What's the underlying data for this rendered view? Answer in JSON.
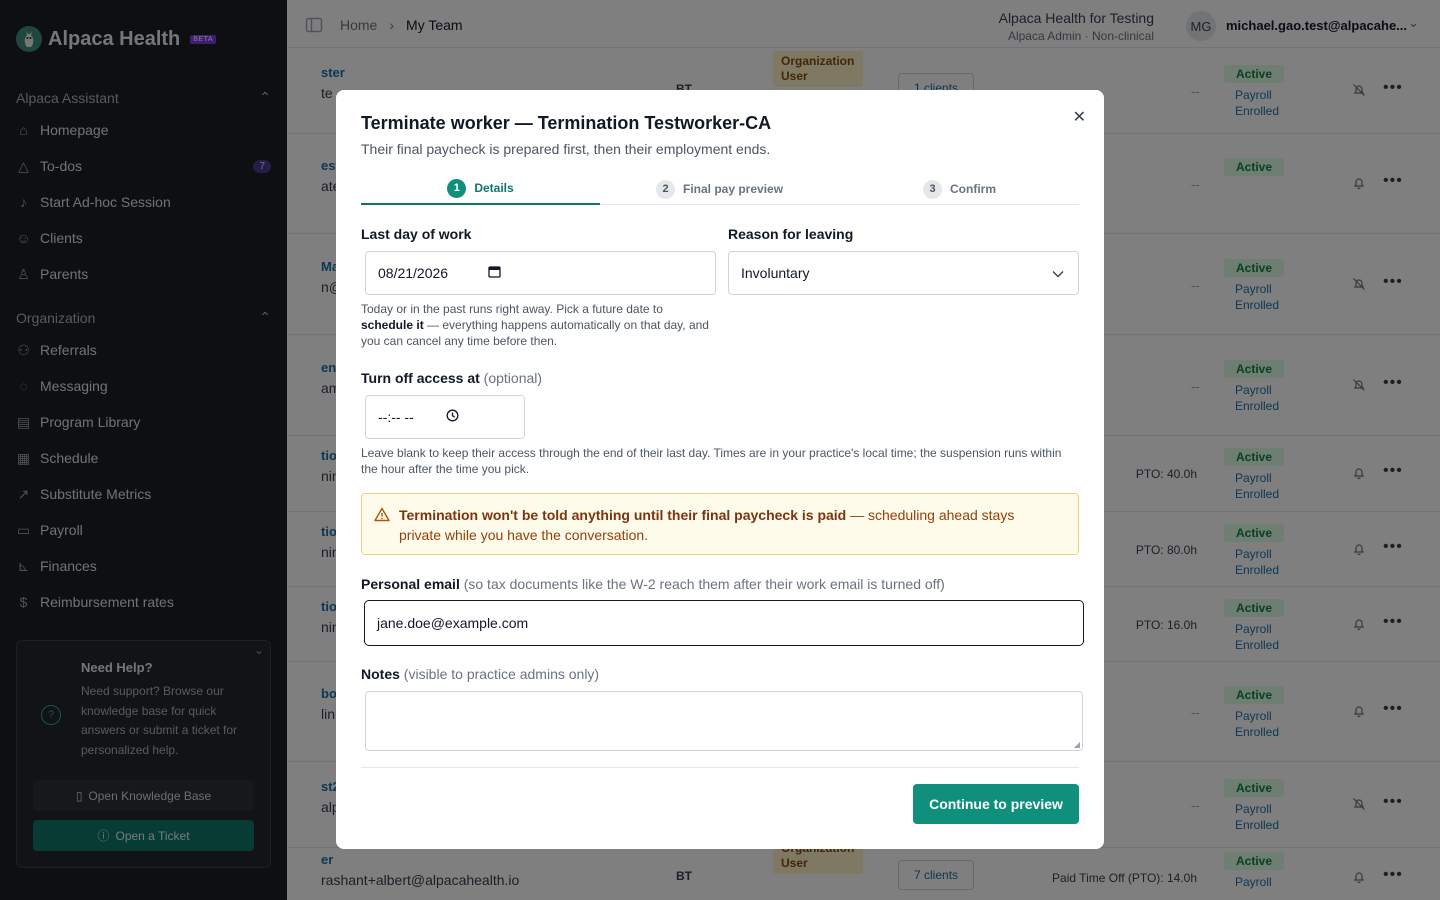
{
  "app": {
    "brand": "Alpaca Health",
    "beta": "BETA"
  },
  "sidebar": {
    "section_assistant": "Alpaca Assistant",
    "assistant_items": [
      {
        "label": "Homepage",
        "icon": "home-icon"
      },
      {
        "label": "To-dos",
        "icon": "warning-icon",
        "badge": "7"
      },
      {
        "label": "Start Ad-hoc Session",
        "icon": "mic-icon"
      },
      {
        "label": "Clients",
        "icon": "users-icon"
      },
      {
        "label": "Parents",
        "icon": "person-icon"
      }
    ],
    "section_org": "Organization",
    "org_items": [
      {
        "label": "Referrals",
        "icon": "referral-icon"
      },
      {
        "label": "Messaging",
        "icon": "chat-icon"
      },
      {
        "label": "Program Library",
        "icon": "library-icon"
      },
      {
        "label": "Schedule",
        "icon": "calendar-icon"
      },
      {
        "label": "Substitute Metrics",
        "icon": "trend-icon"
      },
      {
        "label": "Payroll",
        "icon": "wallet-icon"
      },
      {
        "label": "Finances",
        "icon": "chart-icon"
      },
      {
        "label": "Reimbursement rates",
        "icon": "dollar-icon"
      }
    ],
    "help": {
      "title": "Need Help?",
      "body": "Need support? Browse our knowledge base for quick answers or submit a ticket for personalized help.",
      "kb_button": "Open Knowledge Base",
      "ticket_button": "Open a Ticket"
    }
  },
  "header": {
    "breadcrumb": [
      "Home",
      "My Team"
    ],
    "org_name": "Alpaca Health for Testing",
    "org_sub": "Alpaca Admin · Non-clinical",
    "avatar": "MG",
    "user_email": "michael.gao.test@alpacahe..."
  },
  "table": {
    "rows": [
      {
        "name": "ster",
        "email": "te",
        "initials": "BT",
        "org": "Organization User",
        "clients": "1 clients",
        "status": "Active",
        "payroll": "Payroll Enrolled",
        "pto": "--",
        "bell_off": true
      },
      {
        "name": "est",
        "email": "ate",
        "status": "Active",
        "pto": "--",
        "bell_off": false
      },
      {
        "name": "Ma",
        "email": "n@",
        "status": "Active",
        "payroll": "Payroll Enrolled",
        "pto": "--",
        "bell_off": true
      },
      {
        "name": "en",
        "email": "am",
        "status": "Active",
        "payroll": "Payroll Enrolled",
        "pto": "--",
        "bell_off": true
      },
      {
        "name": "tio",
        "email": "nin",
        "status": "Active",
        "payroll": "Payroll Enrolled",
        "pto": "PTO:  40.0h",
        "bell_off": false
      },
      {
        "name": "tio",
        "email": "nin",
        "status": "Active",
        "payroll": "Payroll Enrolled",
        "pto": "PTO:  80.0h",
        "bell_off": false
      },
      {
        "name": "tio",
        "email": "nin",
        "status": "Active",
        "payroll": "Payroll Enrolled",
        "pto": "PTO:  16.0h",
        "bell_off": false
      },
      {
        "name": "bo",
        "email": "lin",
        "status": "Active",
        "payroll": "Payroll Enrolled",
        "pto": "--",
        "bell_off": false
      },
      {
        "name": "st2",
        "email": "alp",
        "status": "Active",
        "payroll": "Payroll Enrolled",
        "pto": "--",
        "bell_off": true
      },
      {
        "name": "er",
        "email": "rashant+albert@alpacahealth.io",
        "initials": "BT",
        "org": "Organization User",
        "clients": "7 clients",
        "status": "Active",
        "payroll": "Payroll",
        "pto": "Paid Time Off (PTO):  14.0h",
        "bell_off": false
      }
    ]
  },
  "modal": {
    "title": "Terminate worker — Termination Testworker-CA",
    "subtitle": "Their final paycheck is prepared first, then their employment ends.",
    "steps": [
      {
        "num": "1",
        "label": "Details",
        "active": true
      },
      {
        "num": "2",
        "label": "Final pay preview",
        "active": false
      },
      {
        "num": "3",
        "label": "Confirm",
        "active": false
      }
    ],
    "last_day_label": "Last day of work",
    "last_day_value": "08/21/2026",
    "reason_label": "Reason for leaving",
    "reason_value": "Involuntary",
    "date_hint_1": "Today or in the past runs right away. Pick a future date to ",
    "date_hint_bold": "schedule it",
    "date_hint_2": " — everything happens automatically on that day, and you can cancel any time before then.",
    "access_label": "Turn off access at",
    "access_optional": "(optional)",
    "access_value": "--:-- --",
    "access_hint": "Leave blank to keep their access through the end of their last day. Times are in your practice's local time; the suspension runs within the hour after the time you pick.",
    "warning_bold": "Termination won't be told anything until their final paycheck is paid",
    "warning_rest": " — scheduling ahead stays private while you have the conversation.",
    "email_label": "Personal email",
    "email_note": "(so tax documents like the W-2 reach them after their work email is turned off)",
    "email_value": "jane.doe@example.com",
    "notes_label": "Notes",
    "notes_note": "(visible to practice admins only)",
    "notes_value": "",
    "continue_button": "Continue to preview"
  },
  "colors": {
    "accent": "#0f8f7c",
    "sidebar_bg": "#1a1e23",
    "warning_bg": "#fffbea",
    "link": "#1b6fa8"
  }
}
